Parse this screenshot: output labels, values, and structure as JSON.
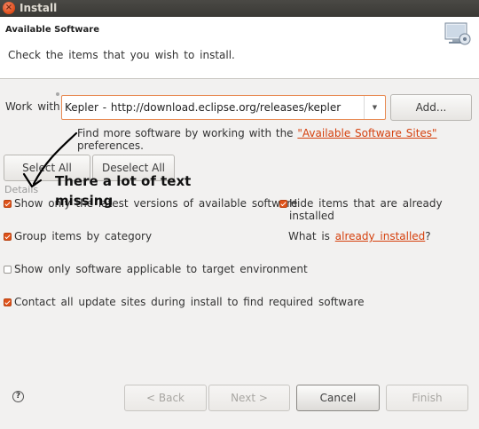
{
  "window": {
    "title": "Install",
    "close_glyph": "×"
  },
  "header": {
    "heading": "Available Software",
    "description": "Check the items that you wish to install.",
    "icon": "install-wizard-icon"
  },
  "work_with": {
    "label": "Work with:",
    "value": "Kepler - http://download.eclipse.org/releases/kepler",
    "dropdown_glyph": "▼",
    "add_button": "Add..."
  },
  "find_more": {
    "prefix": "Find more software by working with the ",
    "link": "\"Available Software Sites\"",
    "suffix": " preferences."
  },
  "selection": {
    "select_all": "Select All",
    "deselect_all": "Deselect All"
  },
  "details_label": "Details",
  "annotation": {
    "line1": "There a lot of text",
    "line2": "missing"
  },
  "options": {
    "show_latest": {
      "label": "Show only the latest versions of available software",
      "checked": true
    },
    "hide_installed": {
      "label": "Hide items that are already installed",
      "checked": true
    },
    "group_by_category": {
      "label": "Group items by category",
      "checked": true
    },
    "what_is": {
      "prefix": "What is ",
      "link": "already installed",
      "suffix": "?"
    },
    "target_env": {
      "label": "Show only software applicable to target environment",
      "checked": false
    },
    "contact_sites": {
      "label": "Contact all update sites during install to find required software",
      "checked": true
    }
  },
  "footer": {
    "help_glyph": "?",
    "back": "< Back",
    "next": "Next >",
    "cancel": "Cancel",
    "finish": "Finish"
  },
  "colors": {
    "accent": "#d5410e",
    "checkbox": "#e0531a",
    "titlebar": "#3c3b37"
  }
}
